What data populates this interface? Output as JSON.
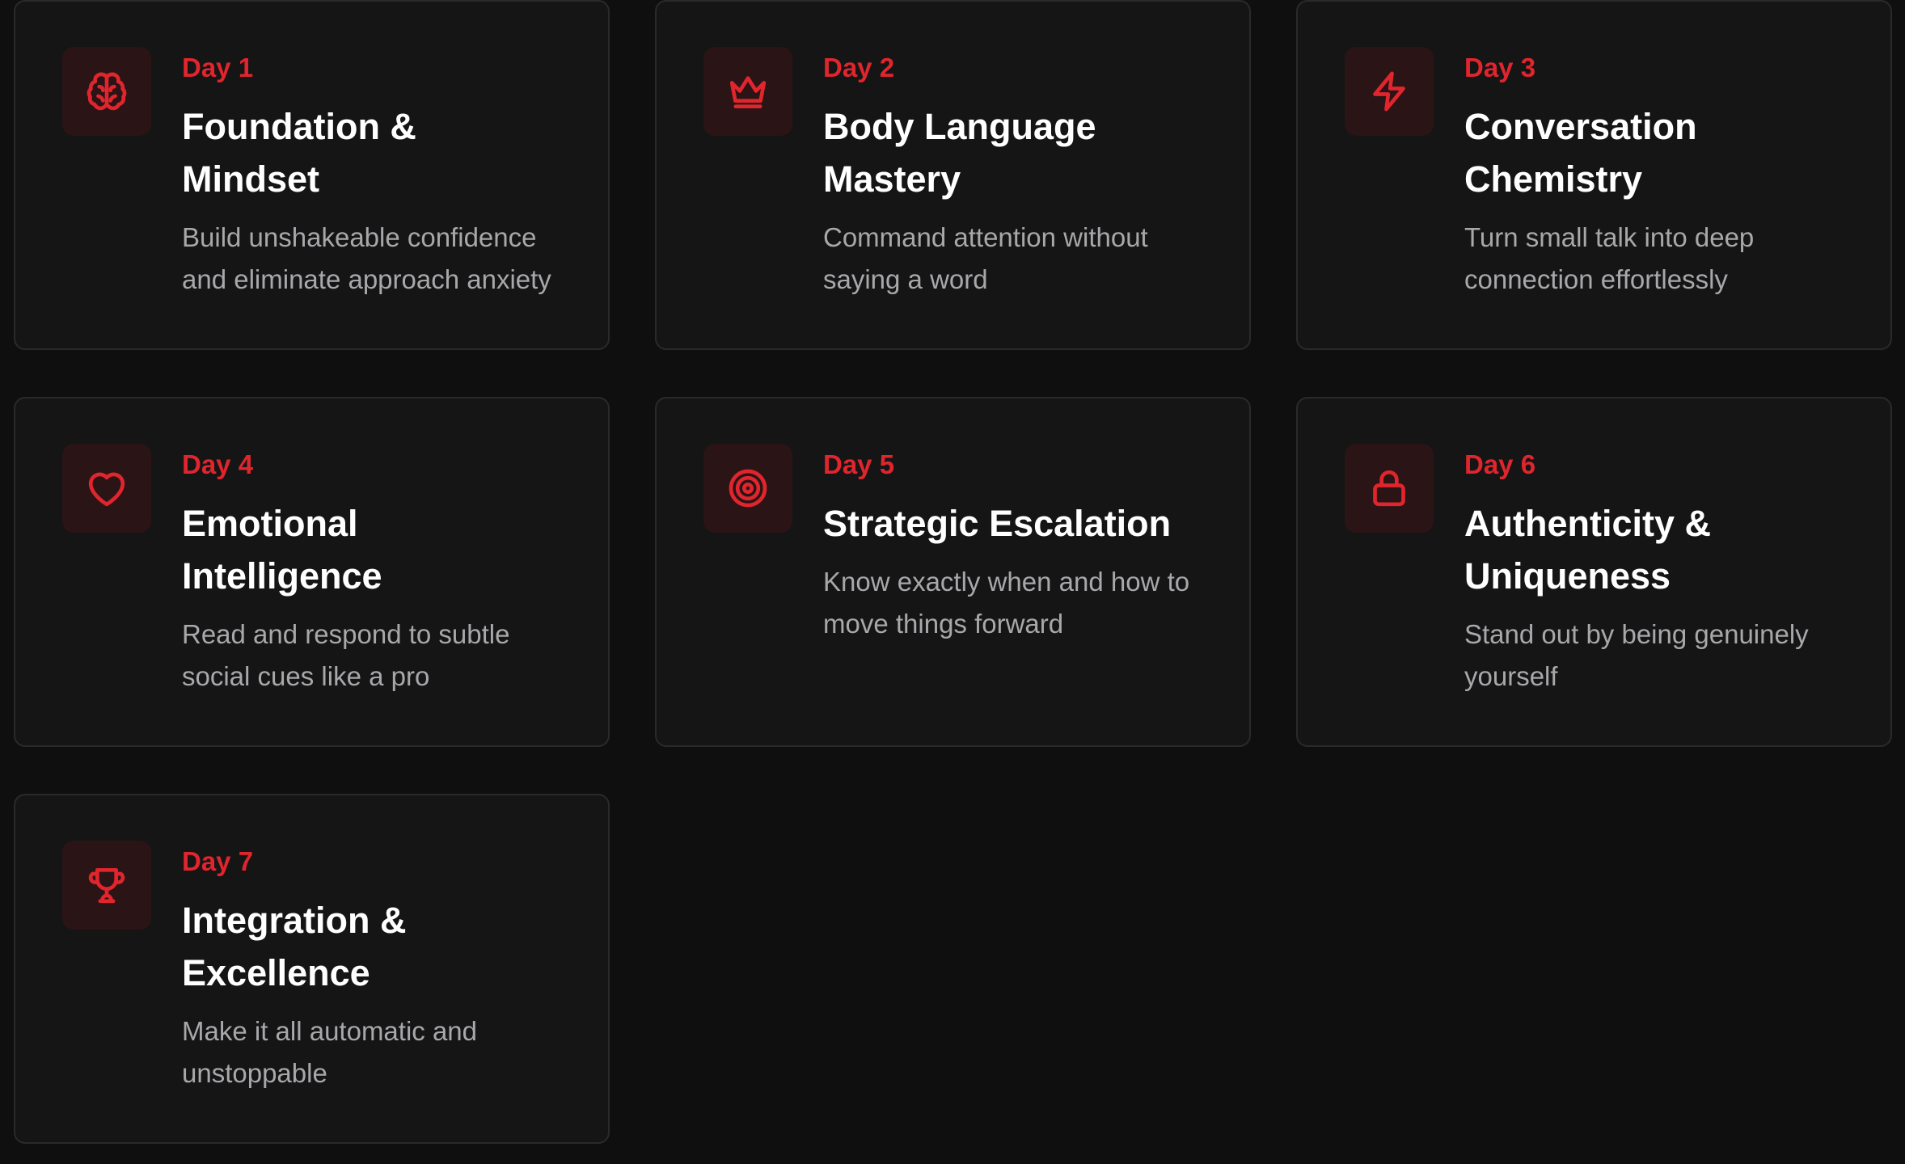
{
  "accent_color": "#e0252d",
  "cards": [
    {
      "day": "Day 1",
      "title": "Foundation & Mindset",
      "description": "Build unshakeable confidence and eliminate approach anxiety",
      "icon": "brain-icon"
    },
    {
      "day": "Day 2",
      "title": "Body Language Mastery",
      "description": "Command attention without saying a word",
      "icon": "crown-icon"
    },
    {
      "day": "Day 3",
      "title": "Conversation Chemistry",
      "description": "Turn small talk into deep connection effortlessly",
      "icon": "lightning-icon"
    },
    {
      "day": "Day 4",
      "title": "Emotional Intelligence",
      "description": "Read and respond to subtle social cues like a pro",
      "icon": "heart-icon"
    },
    {
      "day": "Day 5",
      "title": "Strategic Escalation",
      "description": "Know exactly when and how to move things forward",
      "icon": "target-icon"
    },
    {
      "day": "Day 6",
      "title": "Authenticity & Uniqueness",
      "description": "Stand out by being genuinely yourself",
      "icon": "lock-icon"
    },
    {
      "day": "Day 7",
      "title": "Integration & Excellence",
      "description": "Make it all automatic and unstoppable",
      "icon": "trophy-icon"
    }
  ]
}
